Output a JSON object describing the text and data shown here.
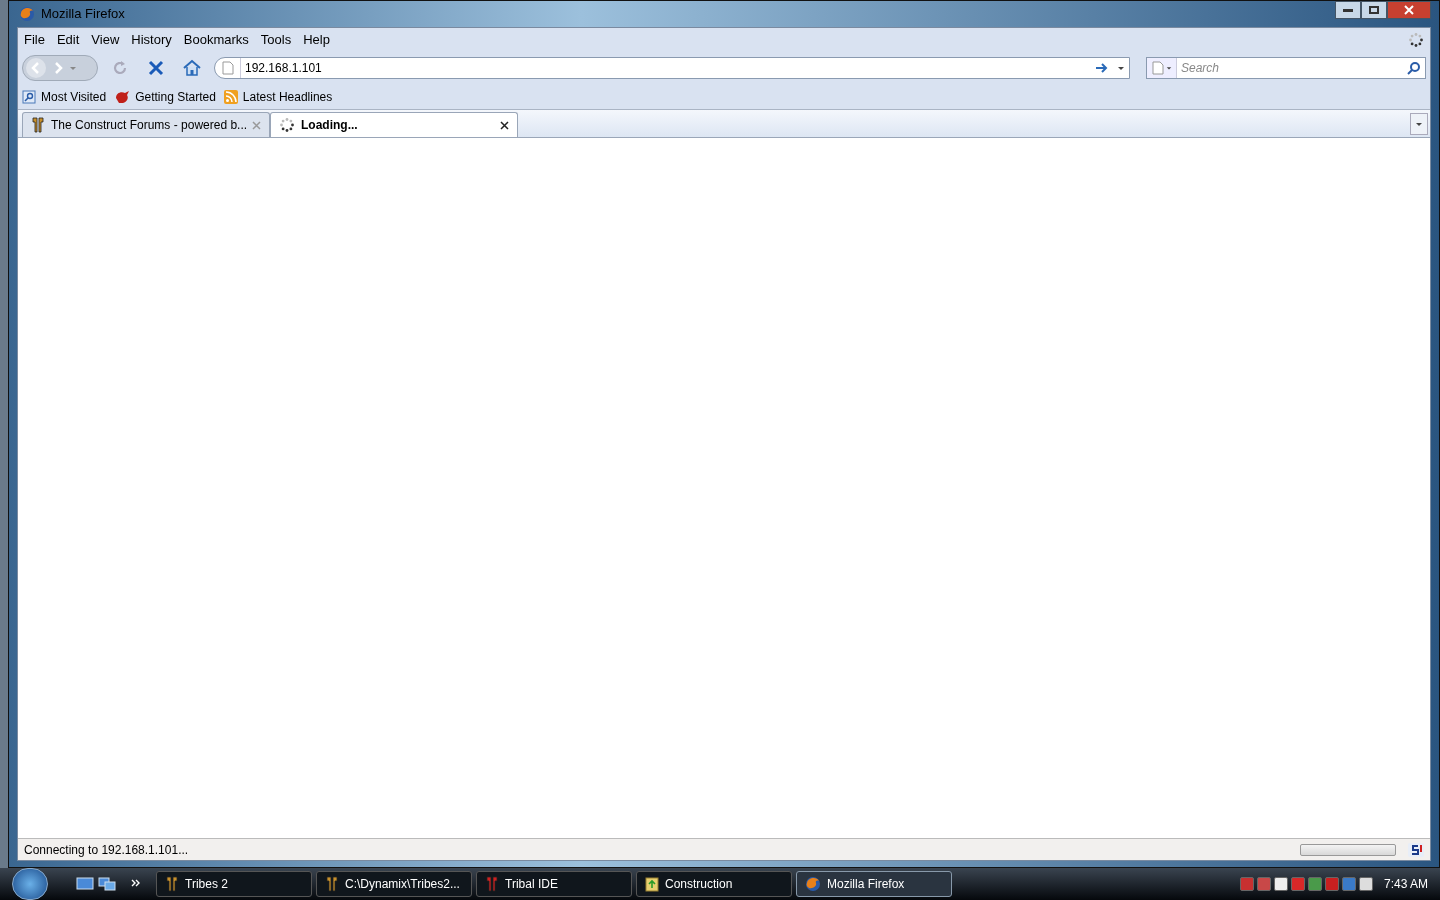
{
  "window": {
    "title": "Mozilla Firefox"
  },
  "menu": [
    "File",
    "Edit",
    "View",
    "History",
    "Bookmarks",
    "Tools",
    "Help"
  ],
  "address": {
    "value": "192.168.1.101"
  },
  "search": {
    "placeholder": "Search"
  },
  "bookmarks": [
    {
      "label": "Most Visited",
      "kind": "folder"
    },
    {
      "label": "Getting Started",
      "kind": "page"
    },
    {
      "label": "Latest Headlines",
      "kind": "feed"
    }
  ],
  "tabs": [
    {
      "label": "The Construct Forums - powered b...",
      "selected": false,
      "loading": false
    },
    {
      "label": "Loading...",
      "selected": true,
      "loading": true
    }
  ],
  "status_bar": {
    "text": "Connecting to 192.168.1.101...",
    "progress": {
      "level": 0
    }
  },
  "taskbar": {
    "items": [
      {
        "label": "Tribes 2",
        "selected": false,
        "kind": "game"
      },
      {
        "label": "C:\\Dynamix\\Tribes2...",
        "selected": false,
        "kind": "game"
      },
      {
        "label": "Tribal IDE",
        "selected": false,
        "kind": "ide"
      },
      {
        "label": "Construction",
        "selected": false,
        "kind": "folder"
      },
      {
        "label": "Mozilla Firefox",
        "selected": true,
        "kind": "browser"
      }
    ],
    "clock": "7:43 AM"
  }
}
